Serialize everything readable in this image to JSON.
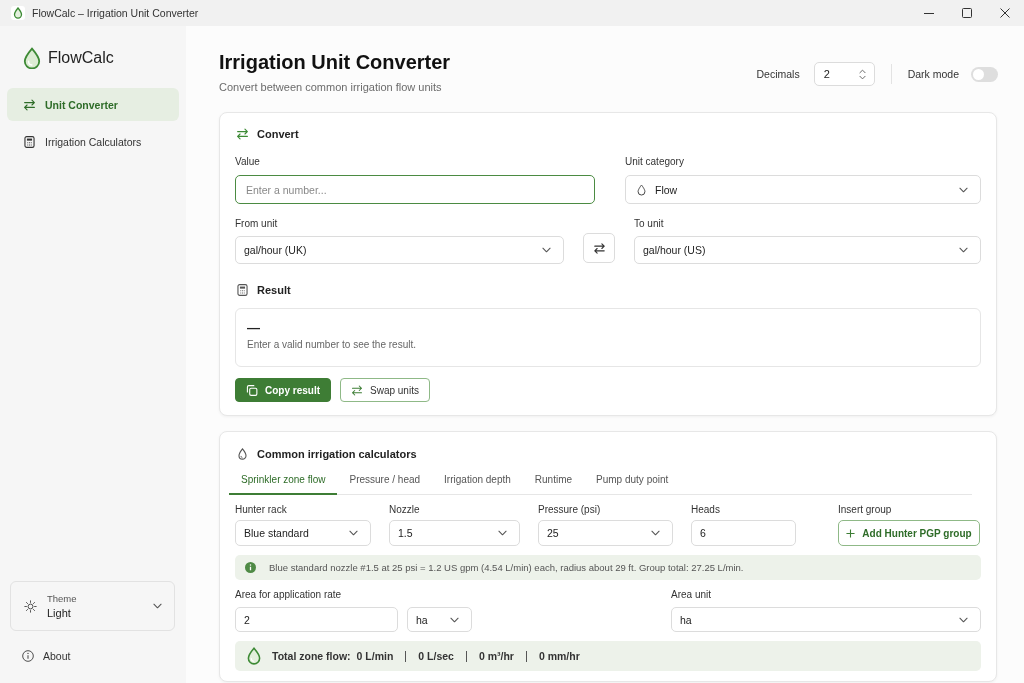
{
  "window": {
    "title": "FlowCalc – Irrigation Unit Converter"
  },
  "sidebar": {
    "app_name": "FlowCalc",
    "nav": [
      {
        "label": "Unit Converter",
        "kind": "converter",
        "selected": true
      },
      {
        "label": "Irrigation Calculators",
        "kind": "calculators",
        "selected": false
      }
    ],
    "theme": {
      "label": "Theme",
      "value": "Light"
    },
    "about": "About"
  },
  "header": {
    "title": "Irrigation Unit Converter",
    "subtitle": "Convert between common irrigation flow units",
    "decimals": {
      "label": "Decimals",
      "value": "2"
    },
    "dark_mode": {
      "label": "Dark mode",
      "on": false
    }
  },
  "converter": {
    "title": "Convert",
    "value_field": {
      "label": "Value",
      "placeholder": "Enter a number...",
      "focused": true
    },
    "unit_category": {
      "label": "Unit category",
      "value": "Flow"
    },
    "from_unit": {
      "label": "From unit",
      "value": "gal/hour (UK)"
    },
    "to_unit": {
      "label": "To unit",
      "value": "gal/hour (US)"
    },
    "result": {
      "title": "Result",
      "value": "—",
      "hint": "Enter a valid number to see the result."
    },
    "buttons": [
      {
        "label": "Copy result",
        "kind": "copy"
      },
      {
        "label": "Swap units",
        "kind": "swap"
      }
    ]
  },
  "calculators": {
    "title": "Common irrigation calculators",
    "tabs": [
      {
        "label": "Sprinkler zone flow",
        "selected": true
      },
      {
        "label": "Pressure / head",
        "selected": false
      },
      {
        "label": "Irrigation depth",
        "selected": false
      },
      {
        "label": "Runtime",
        "selected": false
      },
      {
        "label": "Pump duty point",
        "selected": false
      }
    ],
    "fields": [
      {
        "label": "Hunter rack",
        "value": "Blue standard",
        "kind": "select"
      },
      {
        "label": "Nozzle",
        "value": "1.5",
        "kind": "select"
      },
      {
        "label": "Pressure (psi)",
        "value": "25",
        "kind": "select"
      },
      {
        "label": "Heads",
        "value": "6",
        "kind": "input"
      }
    ],
    "insert_group": {
      "label": "Insert group",
      "button": "Add Hunter PGP group"
    },
    "info": "Blue standard nozzle #1.5 at 25 psi = 1.2 US gpm (4.54 L/min) each, radius about 29 ft. Group total: 27.25 L/min.",
    "area": {
      "label": "Area for application rate",
      "value": "2",
      "unit": "ha"
    },
    "area_unit": {
      "label": "Area unit",
      "value": "ha"
    },
    "total": {
      "label": "Total zone flow:",
      "values": [
        "0 L/min",
        "0 L/sec",
        "0 m³/hr",
        "0 mm/hr"
      ]
    }
  }
}
